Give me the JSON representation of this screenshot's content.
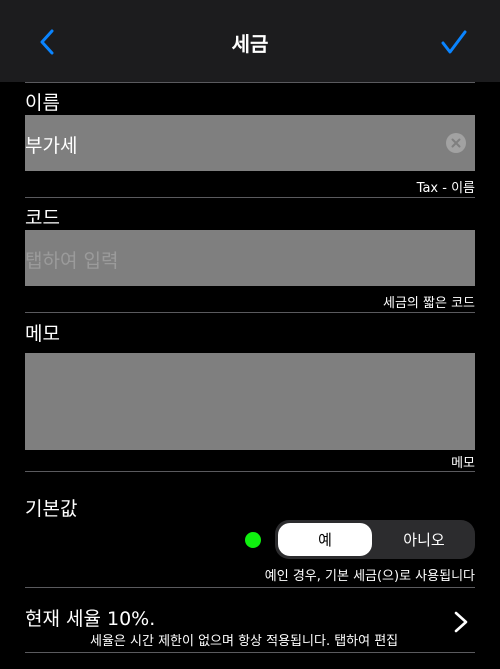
{
  "navbar": {
    "title": "세금",
    "back_icon": "chevron-left-icon",
    "done_icon": "checkmark-icon",
    "accent_color": "#0a84ff"
  },
  "name_section": {
    "label": "이름",
    "value": "부가세",
    "hint": "Tax - 이름"
  },
  "code_section": {
    "label": "코드",
    "placeholder": "탭하여 입력",
    "hint": "세금의 짧은 코드"
  },
  "memo_section": {
    "label": "메모",
    "value": "",
    "hint": "메모"
  },
  "default_section": {
    "label": "기본값",
    "indicator_color": "#0ff00f",
    "options": [
      "예",
      "아니오"
    ],
    "selected": "예",
    "hint": "예인 경우, 기본 세금(으)로 사용됩니다"
  },
  "rate_row": {
    "title": "현재 세율 10%.",
    "subtitle": "세율은 시간 제한이 없으며 항상 적용됩니다. 탭하여 편집",
    "icon": "chevron-right-icon"
  }
}
